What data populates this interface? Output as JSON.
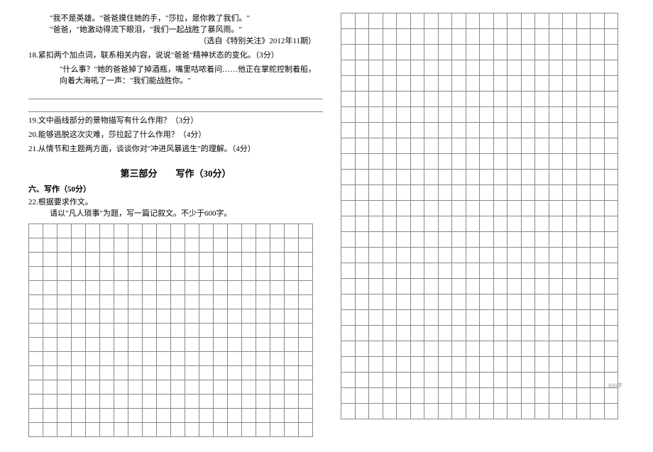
{
  "passage": {
    "line1": "\"我不是英雄。\"爸爸摸住她的手，\"莎拉，是你救了我们。\"",
    "line2": "\"爸爸，\"她激动得流下眼泪，\"我们一起战胜了暴风雨。\"",
    "source": "（选自《特别关注》2012年11期）"
  },
  "q18": {
    "stem": "18.紧扣两个加点词，联系相关内容，说说\"爸爸\"精神状态的变化。（3分）",
    "quote": "\"什么事？\"她的爸爸掉了掉酒瓶，嘴里咕哝着问……他正在掌舵控制着船，向着大海吼了一声：\"我们能战胜你。\""
  },
  "q19": "19.文中画线部分的景物描写有什么作用？（3分）",
  "q20": "20.能够逃脱这次灾难，莎拉起了什么作用？（4分）",
  "q21": "21.从情节和主题两方面，谈谈你对\"冲进风暴逃生\"的理解。（4分）",
  "partTitle": "第三部分　　写作（30分）",
  "section6": "六、写作（50分）",
  "q22": {
    "stem": "22.根据要求作文。",
    "prompt": "请以\"凡人琐事\"为题，写一篇记叙文。不少于600字。"
  },
  "gridLeft": {
    "cols": 20,
    "rows": 15
  },
  "gridRight": {
    "cols": 20,
    "rows": 26
  },
  "charCount": "600字"
}
